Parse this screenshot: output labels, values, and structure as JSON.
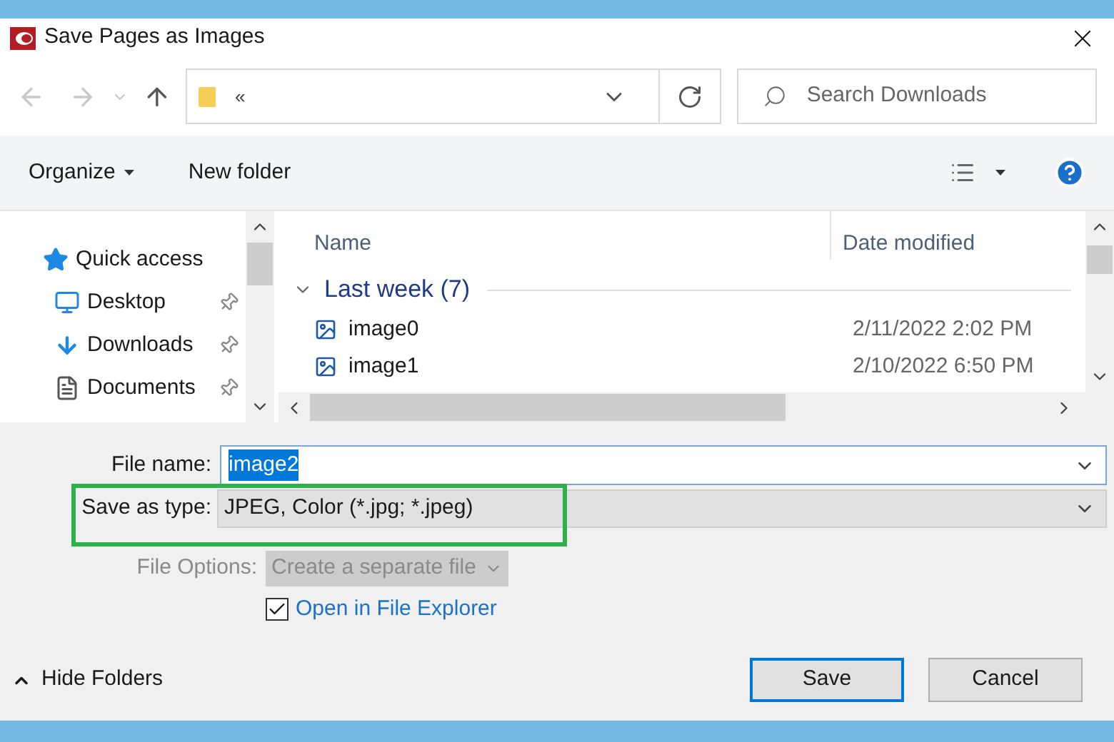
{
  "window": {
    "title": "Save Pages as Images"
  },
  "nav": {
    "address": "«",
    "search_placeholder": "Search Downloads"
  },
  "toolbar": {
    "organize": "Organize",
    "new_folder": "New folder"
  },
  "sidebar": {
    "items": [
      {
        "label": "Quick access",
        "kind": "star",
        "pinned": false
      },
      {
        "label": "Desktop",
        "kind": "desktop",
        "pinned": true
      },
      {
        "label": "Downloads",
        "kind": "download",
        "pinned": true
      },
      {
        "label": "Documents",
        "kind": "document",
        "pinned": true
      }
    ]
  },
  "file_list": {
    "columns": [
      "Name",
      "Date modified"
    ],
    "groups": [
      {
        "label": "Last week (7)",
        "expanded": true,
        "files": [
          {
            "name": "image0",
            "date": "2/11/2022 2:02 PM"
          },
          {
            "name": "image1",
            "date": "2/10/2022 6:50 PM"
          }
        ]
      }
    ]
  },
  "form": {
    "file_name_label": "File name:",
    "file_name": "image2",
    "file_name_selected": true,
    "save_type_label": "Save as type:",
    "save_type": "JPEG, Color (*.jpg; *.jpeg)",
    "save_type_highlighted": true,
    "file_options_label": "File Options:",
    "file_options": "Create a separate file",
    "file_options_disabled": true,
    "open_explorer": {
      "label": "Open in File Explorer",
      "checked": true
    }
  },
  "footer": {
    "hide_folders": "Hide Folders",
    "buttons": [
      {
        "label": "Save",
        "default": true
      },
      {
        "label": "Cancel",
        "default": false
      }
    ]
  }
}
